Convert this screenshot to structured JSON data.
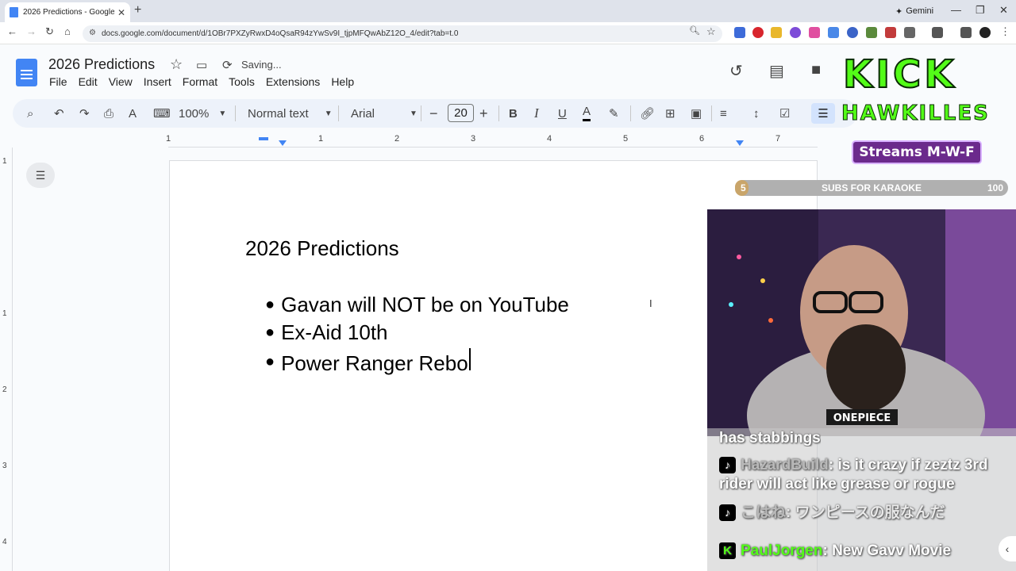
{
  "browser": {
    "tab_title": "2026 Predictions - Google Docs",
    "gemini_label": "Gemini",
    "url": "docs.google.com/document/d/1OBr7PXZyRwxD4oQsaR94zYwSv9I_tjpMFQwAbZ12O_4/edit?tab=t.0"
  },
  "doc": {
    "title": "2026 Predictions",
    "status": "Saving...",
    "menu": [
      "File",
      "Edit",
      "View",
      "Insert",
      "Format",
      "Tools",
      "Extensions",
      "Help"
    ]
  },
  "toolbar": {
    "zoom": "100%",
    "style": "Normal text",
    "font": "Arial",
    "font_size": "20"
  },
  "ruler": {
    "numbers": [
      "1",
      "1",
      "2",
      "3",
      "4",
      "5",
      "6",
      "7"
    ]
  },
  "vruler": {
    "numbers": [
      "1",
      "1",
      "2",
      "3",
      "4"
    ]
  },
  "content": {
    "heading": "2026 Predictions",
    "bullets": [
      "Gavan will NOT be on YouTube",
      "Ex-Aid 10th",
      "Power Ranger Rebo"
    ]
  },
  "overlay": {
    "logo_line1": "KICK",
    "logo_line2": "HAWKILLES",
    "streams": "Streams M-W-F",
    "subs": {
      "current": "5",
      "label": "SUBS FOR KARAOKE",
      "goal": "100",
      "progress": 0.05
    },
    "chat": [
      {
        "user": "",
        "text": "has stabbings"
      },
      {
        "user": "HazardBuild",
        "text": ": is it crazy if zeztz 3rd rider will act like grease or rogue"
      },
      {
        "user": "こはね",
        "text": ": ワンピースの服なんだ"
      },
      {
        "user": "PaulJorgen",
        "text": ": New Gavv Movie"
      }
    ],
    "shirt_text": "ONEPIECE"
  }
}
